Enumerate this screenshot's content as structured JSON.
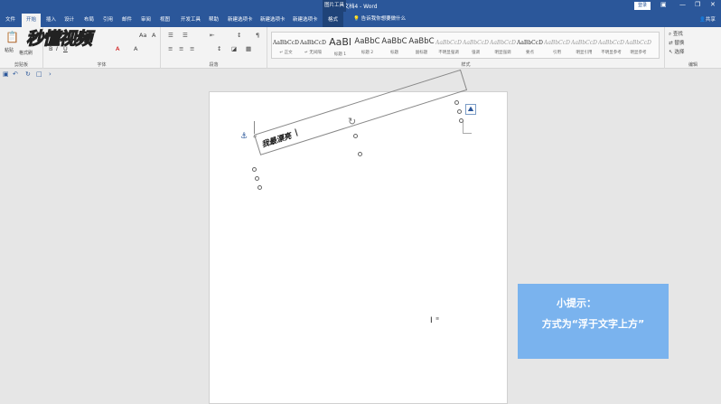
{
  "titlebar": {
    "title": "文档4 - Word",
    "context_group": "图片工具",
    "login_label": "登录"
  },
  "tabs": [
    {
      "label": "文件"
    },
    {
      "label": "开始"
    },
    {
      "label": "插入"
    },
    {
      "label": "设计"
    },
    {
      "label": "布局"
    },
    {
      "label": "引用"
    },
    {
      "label": "邮件"
    },
    {
      "label": "审阅"
    },
    {
      "label": "视图"
    },
    {
      "label": "开发工具"
    },
    {
      "label": "帮助"
    },
    {
      "label": "新建选项卡"
    },
    {
      "label": "新建选项卡"
    },
    {
      "label": "新建选项卡"
    },
    {
      "label": "格式"
    }
  ],
  "active_tab": "开始",
  "tell_me": "告诉我你想要做什么",
  "share_label": "共享",
  "ribbon": {
    "clipboard": {
      "paste": "粘贴",
      "format_painter": "格式刷",
      "label": "剪贴板"
    },
    "font": {
      "label": "字体"
    },
    "paragraph": {
      "label": "段落"
    },
    "styles": {
      "label": "样式",
      "items": [
        {
          "sample": "AaBbCcDi",
          "name": "↵ 正文"
        },
        {
          "sample": "AaBbCcDi",
          "name": "↵ 无间隔"
        },
        {
          "sample": "AaBl",
          "name": "标题 1"
        },
        {
          "sample": "AaBbC",
          "name": "标题 2"
        },
        {
          "sample": "AaBbC",
          "name": "标题"
        },
        {
          "sample": "AaBbC",
          "name": "副标题"
        },
        {
          "sample": "AaBbCcDi",
          "name": "不明显强调"
        },
        {
          "sample": "AaBbCcDi",
          "name": "强调"
        },
        {
          "sample": "AaBbCcDi",
          "name": "明显强调"
        },
        {
          "sample": "AaBbCcDi",
          "name": "要点"
        },
        {
          "sample": "AaBbCcDi",
          "name": "引用"
        },
        {
          "sample": "AaBbCcDi",
          "name": "明显引用"
        },
        {
          "sample": "AaBbCcDi",
          "name": "不明显参考"
        },
        {
          "sample": "AaBbCcDi",
          "name": "明显参考"
        }
      ]
    },
    "editing": {
      "find": "查找",
      "replace": "替换",
      "select": "选择",
      "label": "编辑"
    }
  },
  "document": {
    "textbox_text": "我最漂亮"
  },
  "watermark": "秒懂视频",
  "tip": {
    "line1": "小提示：",
    "line2": "方式为“浮于文字上方”"
  }
}
